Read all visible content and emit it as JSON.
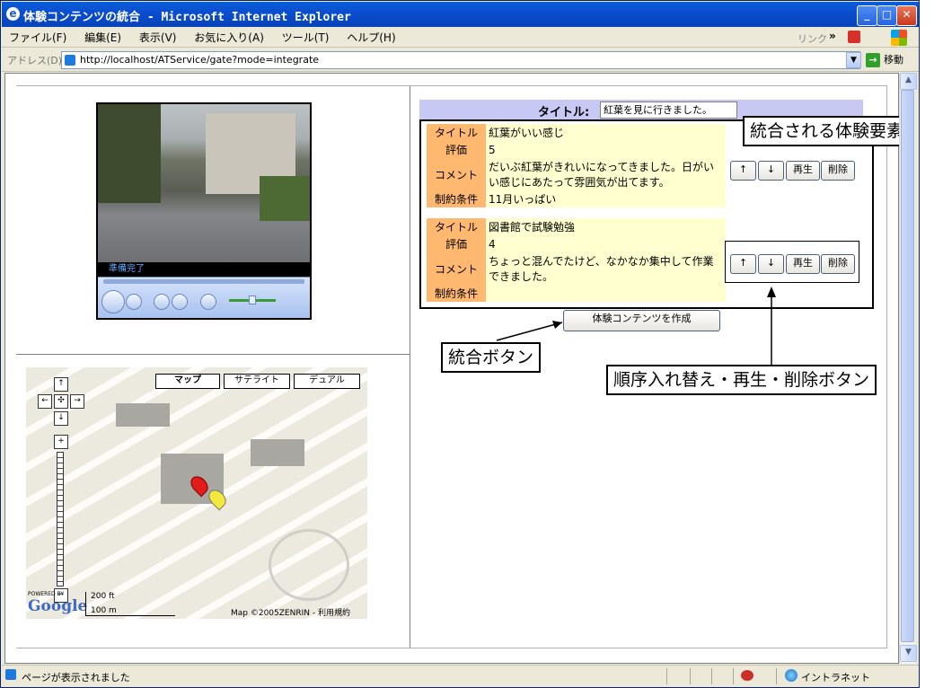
{
  "window": {
    "title": "体験コンテンツの統合 - Microsoft Internet Explorer",
    "min_label": "_",
    "max_label": "□",
    "close_label": "✕"
  },
  "menu": {
    "items": [
      "ファイル(F)",
      "編集(E)",
      "表示(V)",
      "お気に入り(A)",
      "ツール(T)",
      "ヘルプ(H)"
    ],
    "links_label": "リンク",
    "links_chevron": "»"
  },
  "address": {
    "label": "アドレス(D)",
    "url": "http://localhost/ATService/gate?mode=integrate",
    "go_label": "移動"
  },
  "player": {
    "status": "準備完了"
  },
  "map": {
    "buttons": [
      "マップ",
      "サテライト",
      "デュアル"
    ],
    "scale_ft": "200 ft",
    "scale_m": "100 m",
    "copyright": "Map ©2005ZENRIN - 利用規約",
    "powered": "POWERED BY",
    "google": "Google"
  },
  "form": {
    "title_label": "タイトル:",
    "title_value": "紅葉を見に行きました。"
  },
  "experiences": [
    {
      "title_label": "タイトル",
      "title": "紅葉がいい感じ",
      "rating_label": "評価",
      "rating": "5",
      "comment_label": "コメント",
      "comment": "だいぶ紅葉がきれいになってきました。日がいい感じにあたって雰囲気が出てます。",
      "constraint_label": "制約条件",
      "constraint": "11月いっぱい"
    },
    {
      "title_label": "タイトル",
      "title": "図書館で試験勉強",
      "rating_label": "評価",
      "rating": "4",
      "comment_label": "コメント",
      "comment": "ちょっと混んでたけど、なかなか集中して作業できました。",
      "constraint_label": "制約条件",
      "constraint": ""
    }
  ],
  "buttons": {
    "up": "↑",
    "down": "↓",
    "play": "再生",
    "delete": "削除",
    "create": "体験コンテンツを作成"
  },
  "callouts": {
    "integrated_elements": "統合される体験要素",
    "integrate_button": "統合ボタン",
    "reorder_buttons": "順序入れ替え・再生・削除ボタン"
  },
  "status": {
    "message": "ページが表示されました",
    "zone": "イントラネット"
  },
  "colors": {
    "title_bg": "#c8c8f4",
    "label_bg": "#ffb870",
    "value_bg": "#ffffd0",
    "titlebar": "#0b4ed0"
  }
}
